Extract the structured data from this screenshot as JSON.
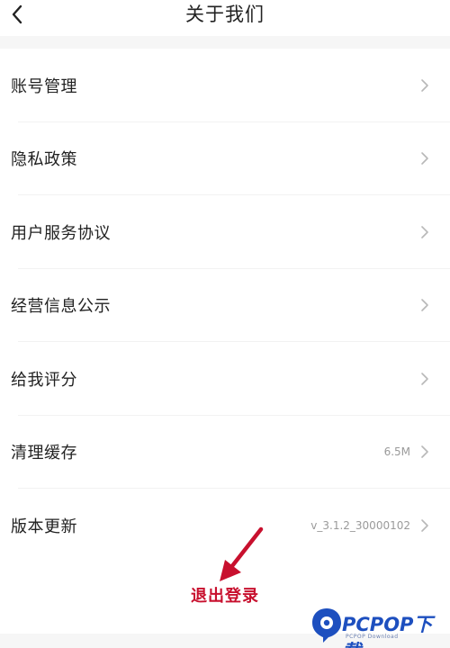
{
  "header": {
    "title": "关于我们",
    "back_icon": "chevron-left-icon"
  },
  "menu": {
    "items": [
      {
        "label": "账号管理",
        "value": ""
      },
      {
        "label": "隐私政策",
        "value": ""
      },
      {
        "label": "用户服务协议",
        "value": ""
      },
      {
        "label": "经营信息公示",
        "value": ""
      },
      {
        "label": "给我评分",
        "value": ""
      },
      {
        "label": "清理缓存",
        "value": "6.5M"
      },
      {
        "label": "版本更新",
        "value": "v_3.1.2_30000102"
      }
    ]
  },
  "logout": {
    "label": "退出登录"
  },
  "watermark": {
    "brand": "PCPOP下载",
    "sub": "PCPOP Download"
  },
  "colors": {
    "accent": "#c8102e",
    "text": "#222222",
    "muted": "#9a9a9a",
    "chevron": "#b8b8b8",
    "watermark": "#1d4fbf"
  }
}
